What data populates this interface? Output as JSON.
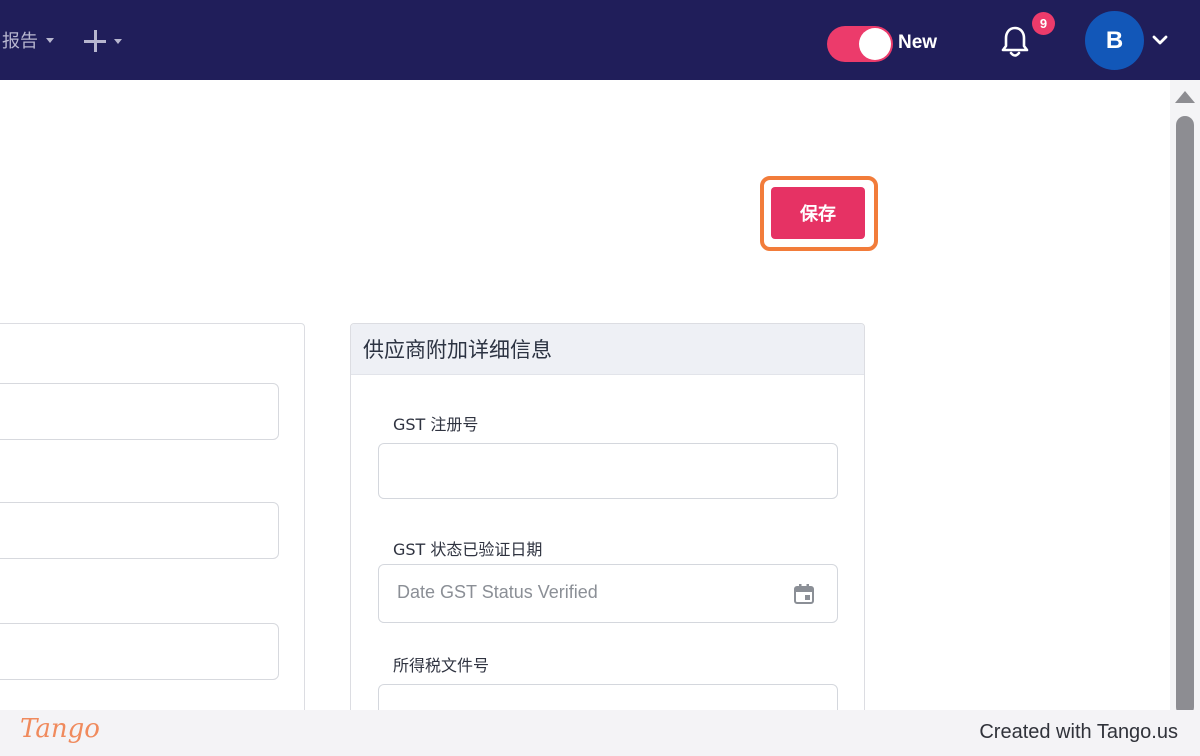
{
  "nav": {
    "report_label": "报告",
    "toggle_label": "New",
    "notification_count": "9",
    "avatar_initial": "B"
  },
  "actions": {
    "save_label": "保存"
  },
  "supplier_details": {
    "title": "供应商附加详细信息",
    "gst_reg_label": "GST 注册号",
    "gst_date_label": "GST 状态已验证日期",
    "gst_date_placeholder": "Date GST Status Verified",
    "tax_doc_label": "所得税文件号"
  },
  "footer": {
    "brand": "Tango",
    "created_text": "Created with Tango.us"
  },
  "colors": {
    "nav_bg": "#201e5a",
    "accent": "#e63264",
    "highlight": "#f27c3a",
    "avatar": "#1257b8"
  }
}
